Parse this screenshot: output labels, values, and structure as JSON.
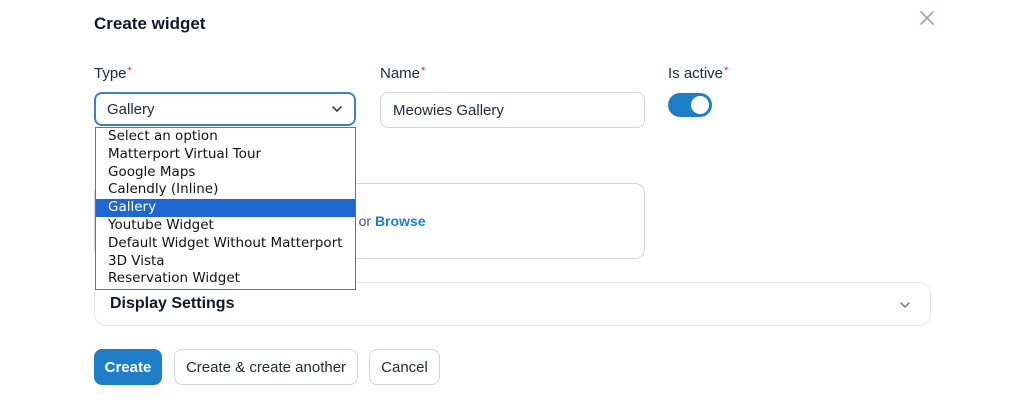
{
  "modal": {
    "title": "Create widget",
    "close_icon": "close-icon"
  },
  "form": {
    "type": {
      "label": "Type",
      "required_mark": "*",
      "selected_value": "Gallery",
      "options": [
        "Select an option",
        "Matterport Virtual Tour",
        "Google Maps",
        "Calendly (Inline)",
        "Gallery",
        "Youtube Widget",
        "Default Widget Without Matterport",
        "3D Vista",
        "Reservation Widget"
      ],
      "highlighted_option": "Gallery"
    },
    "name": {
      "label": "Name",
      "required_mark": "*",
      "value": "Meowies Gallery"
    },
    "is_active": {
      "label": "Is active",
      "required_mark": "*",
      "state": "on"
    },
    "upload": {
      "partial_text": "ur files or ",
      "browse_link": "Browse"
    }
  },
  "display_settings": {
    "title": "Display Settings",
    "icon": "chevron-down-icon"
  },
  "actions": {
    "create_label": "Create",
    "create_another_label": "Create & create another",
    "cancel_label": "Cancel"
  },
  "colors": {
    "accent": "#1e7fc8",
    "selected_option_bg": "#1e66d0",
    "required_mark": "#e11d48"
  }
}
